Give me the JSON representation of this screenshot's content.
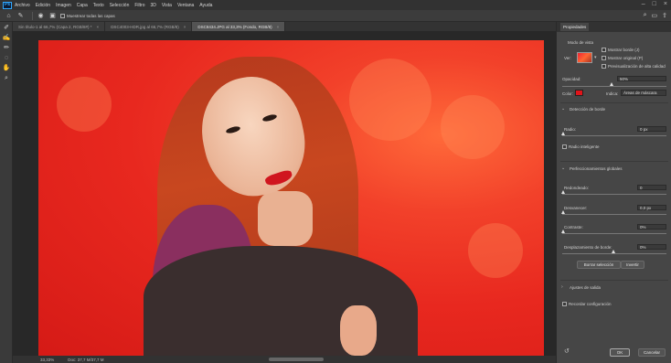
{
  "menu": {
    "logo": "Ps",
    "items": [
      "Archivo",
      "Edición",
      "Imagen",
      "Capa",
      "Texto",
      "Selección",
      "Filtro",
      "3D",
      "Vista",
      "Ventana",
      "Ayuda"
    ]
  },
  "options": {
    "sample_all_layers": "Muestrear todas las capas"
  },
  "tabs": [
    {
      "label": "Sin título-1 al 66,7% (Capa 2, RGB/8#) *"
    },
    {
      "label": "DSC4003-HDR.jpg al 66,7% (RGB/8)"
    },
    {
      "label": "DSC8434.JPG al 33,3% (Fondo, RGB/8)"
    }
  ],
  "status": {
    "zoom": "33,33%",
    "doc": "Doc: 37,7 M/37,7 M"
  },
  "panel": {
    "title": "Propiedades",
    "view_mode_label": "Modo de vista",
    "view_label": "Ver:",
    "show_edge": "Mostrar borde (J)",
    "show_original": "Mostrar original (P)",
    "hq_preview": "Previsualización de alta calidad",
    "opacity_label": "Opacidad:",
    "opacity_value": "50%",
    "color_label": "Color:",
    "indicates_label": "Indica:",
    "indicates_value": "Áreas de máscara",
    "edge_detection": "Detección de borde",
    "radius_label": "Radio:",
    "radius_value": "0 px",
    "smart_radius": "Radio inteligente",
    "global_refinements": "Perfeccionamientos globales",
    "smooth_label": "Redondeado:",
    "smooth_value": "0",
    "feather_label": "Desvanecer:",
    "feather_value": "0,0 px",
    "contrast_label": "Contraste:",
    "contrast_value": "0%",
    "shift_edge_label": "Desplazamiento de borde:",
    "shift_edge_value": "0%",
    "clear_selection": "Borrar selección",
    "invert": "Invertir",
    "output_settings": "Ajustes de salida",
    "remember_settings": "Recordar configuración",
    "ok": "OK",
    "cancel": "Cancelar",
    "overlay_color": "#e0141a"
  }
}
